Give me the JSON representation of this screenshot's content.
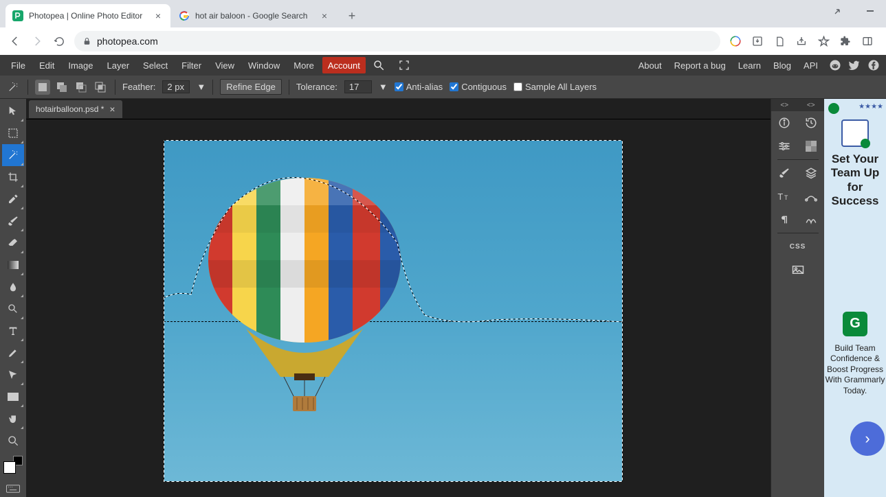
{
  "browser": {
    "tabs": [
      {
        "title": "Photopea | Online Photo Editor",
        "active": true
      },
      {
        "title": "hot air baloon - Google Search",
        "active": false
      }
    ],
    "url": "photopea.com"
  },
  "menubar": {
    "items": [
      "File",
      "Edit",
      "Image",
      "Layer",
      "Select",
      "Filter",
      "View",
      "Window",
      "More"
    ],
    "account": "Account",
    "right": [
      "About",
      "Report a bug",
      "Learn",
      "Blog",
      "API"
    ]
  },
  "options": {
    "feather_label": "Feather:",
    "feather_value": "2 px",
    "refine": "Refine Edge",
    "tolerance_label": "Tolerance:",
    "tolerance_value": "17",
    "antialias": "Anti-alias",
    "contiguous": "Contiguous",
    "sample_all": "Sample All Layers"
  },
  "document": {
    "tab": "hotairballoon.psd *"
  },
  "ad": {
    "headline": "Set Your Team Up for Success",
    "body": "Build Team Confidence & Boost Progress With Grammarly Today.",
    "stars": "★★★★"
  },
  "right_panel": {
    "css": "CSS",
    "tabs": [
      "<>",
      "<>"
    ]
  }
}
